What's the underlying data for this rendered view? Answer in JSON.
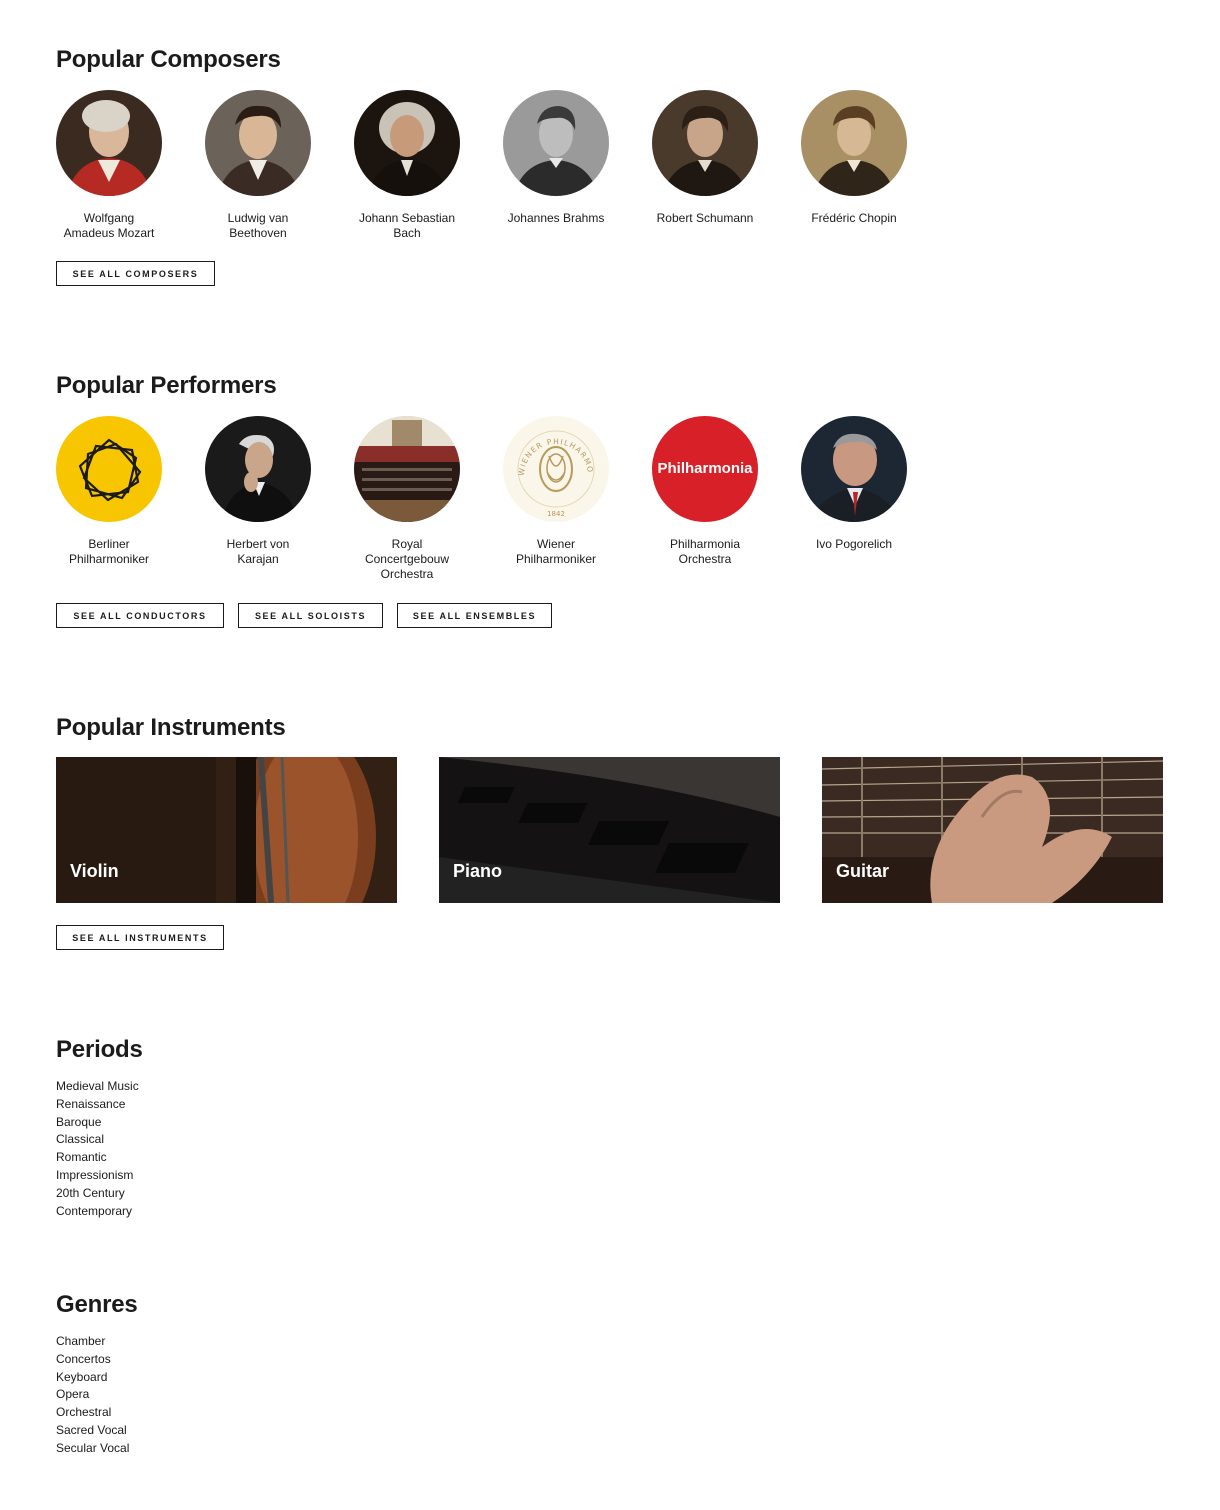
{
  "composers": {
    "title": "Popular Composers",
    "items": [
      {
        "name": "Wolfgang Amadeus Mozart"
      },
      {
        "name": "Ludwig van Beethoven"
      },
      {
        "name": "Johann Sebastian Bach"
      },
      {
        "name": "Johannes Brahms"
      },
      {
        "name": "Robert Schumann"
      },
      {
        "name": "Frédéric Chopin"
      }
    ],
    "button": "See all composers"
  },
  "performers": {
    "title": "Popular Performers",
    "items": [
      {
        "name": "Berliner Philharmoniker"
      },
      {
        "name": "Herbert von Karajan"
      },
      {
        "name": "Royal Concertgebouw Orchestra"
      },
      {
        "name": "Wiener Philharmoniker"
      },
      {
        "name": "Philharmonia Orchestra",
        "logo_text": "Philharmonia"
      },
      {
        "name": "Ivo Pogorelich"
      }
    ],
    "buttons": [
      "See all conductors",
      "See all soloists",
      "See all ensembles"
    ],
    "wiener_logo_text": "WIENER PHILHARMONIKER",
    "wiener_logo_year": "1842"
  },
  "instruments": {
    "title": "Popular Instruments",
    "items": [
      {
        "label": "Violin"
      },
      {
        "label": "Piano"
      },
      {
        "label": "Guitar"
      }
    ],
    "button": "See all instruments"
  },
  "periods": {
    "title": "Periods",
    "items": [
      "Medieval Music",
      "Renaissance",
      "Baroque",
      "Classical",
      "Romantic",
      "Impressionism",
      "20th Century",
      "Contemporary"
    ]
  },
  "genres": {
    "title": "Genres",
    "items": [
      "Chamber",
      "Concertos",
      "Keyboard",
      "Opera",
      "Orchestral",
      "Sacred Vocal",
      "Secular Vocal"
    ]
  },
  "colors": {
    "berliner_yellow": "#f7c600",
    "philharmonia_red": "#d72027",
    "text": "#1b1b1b"
  }
}
